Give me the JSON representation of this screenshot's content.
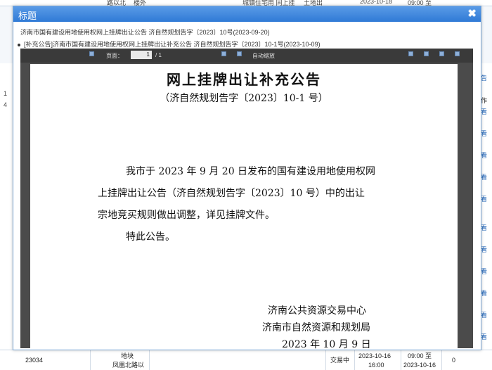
{
  "background": {
    "top_row": [
      "路以北",
      "楼外",
      "城镇住宅用 同上挂",
      "土地出",
      "2023-10-18",
      "09:00 至"
    ],
    "right_col": {
      "header_link": "公告",
      "header_label": "操作",
      "view_label": "查看"
    },
    "left_col_marks": [
      "1",
      "4"
    ],
    "bottom_row": {
      "id": "23034",
      "name_line1": "地块",
      "name_line2": "凤凰北路以",
      "status": "交易中",
      "date_line1": "2023-10-16",
      "date_line2": "16:00",
      "time_line1": "09:00 至",
      "time_line2": "2023-10-16",
      "count": "0"
    }
  },
  "dialog": {
    "title": "标题",
    "close_symbol": "✖",
    "notice_line1": "济南市国有建设用地使用权网上挂牌出让公告 济自然规划告字〔2023〕10号(2023-09-20)",
    "notice_line2": "[补充公告]济南市国有建设用地使用权网上挂牌出让补充公告 济自然规划告字〔2023〕10-1号(2023-10-09)"
  },
  "viewer": {
    "page_label": "页面：",
    "page_current": "1",
    "page_total": "/ 1",
    "zoom_label": "自动缩放"
  },
  "document": {
    "title": "网上挂牌出让补充公告",
    "subtitle": "（济自然规划告字〔2023〕10-1 号）",
    "paragraph": [
      "我市于 2023 年 9 月 20 日发布的国有建设用地使用权网",
      "上挂牌出让公告（济自然规划告字〔2023〕10 号）中的出让",
      "宗地竞买规则做出调整，详见挂牌文件。",
      "特此公告。"
    ],
    "signature": {
      "org1": "济南公共资源交易中心",
      "org2": "济南市自然资源和规划局",
      "date": "2023 年 10 月 9 日"
    }
  }
}
